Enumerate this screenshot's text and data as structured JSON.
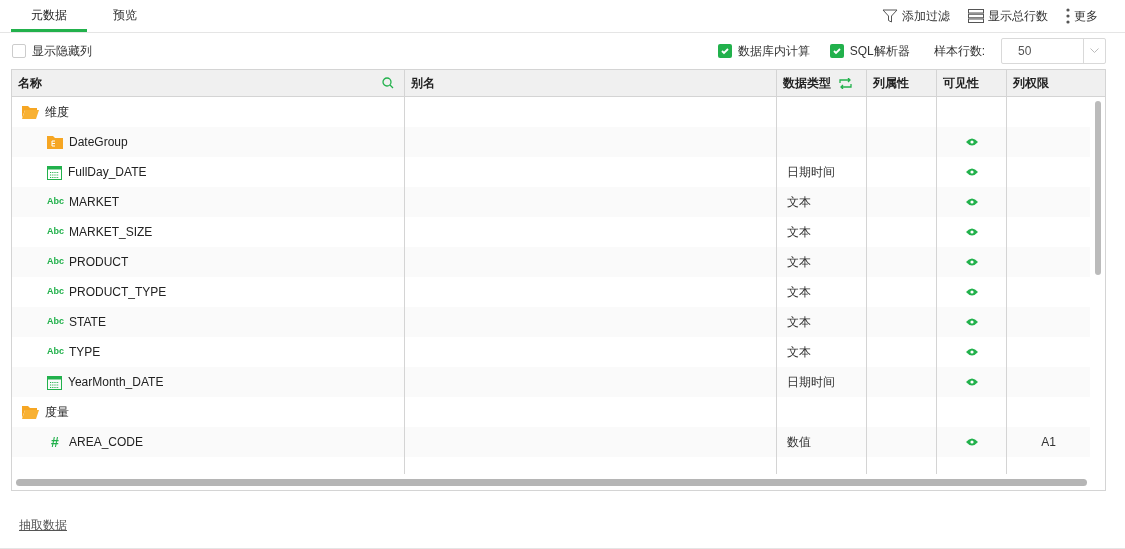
{
  "tabs": [
    {
      "label": "元数据",
      "selected": true
    },
    {
      "label": "预览",
      "selected": false
    }
  ],
  "toolbar": [
    {
      "kind": "filter",
      "label": "添加过滤"
    },
    {
      "kind": "rows",
      "label": "显示总行数"
    },
    {
      "kind": "more",
      "label": "更多"
    }
  ],
  "options": {
    "show_hidden": {
      "label": "显示隐藏列",
      "checked": false
    },
    "in_db": {
      "label": "数据库内计算",
      "checked": true
    },
    "sql_parser": {
      "label": "SQL解析器",
      "checked": true
    },
    "sample_rows": {
      "label": "样本行数:",
      "value": "50"
    }
  },
  "table": {
    "columns": [
      "名称",
      "别名",
      "数据类型",
      "列属性",
      "可见性",
      "列权限"
    ],
    "rows": [
      {
        "kind": "folder",
        "name": "维度"
      },
      {
        "kind": "group",
        "name": "DateGroup",
        "type": "",
        "visible": true,
        "permission": ""
      },
      {
        "kind": "date",
        "name": "FullDay_DATE",
        "type": "日期时间",
        "visible": true,
        "permission": ""
      },
      {
        "kind": "text",
        "icon": "Abc",
        "name": "MARKET",
        "type": "文本",
        "visible": true,
        "permission": ""
      },
      {
        "kind": "text",
        "icon": "Abc",
        "name": "MARKET_SIZE",
        "type": "文本",
        "visible": true,
        "permission": ""
      },
      {
        "kind": "text",
        "icon": "Abc",
        "name": "PRODUCT",
        "type": "文本",
        "visible": true,
        "permission": ""
      },
      {
        "kind": "text",
        "icon": "Abc",
        "name": "PRODUCT_TYPE",
        "type": "文本",
        "visible": true,
        "permission": ""
      },
      {
        "kind": "text",
        "icon": "Abc",
        "name": "STATE",
        "type": "文本",
        "visible": true,
        "permission": ""
      },
      {
        "kind": "text",
        "icon": "Abc",
        "name": "TYPE",
        "type": "文本",
        "visible": true,
        "permission": ""
      },
      {
        "kind": "date",
        "name": "YearMonth_DATE",
        "type": "日期时间",
        "visible": true,
        "permission": ""
      },
      {
        "kind": "folder",
        "name": "度量"
      },
      {
        "kind": "text",
        "icon": "#",
        "name": "AREA_CODE",
        "type": "数值",
        "visible": true,
        "permission": "A1"
      }
    ]
  },
  "footer_link": "抽取数据"
}
